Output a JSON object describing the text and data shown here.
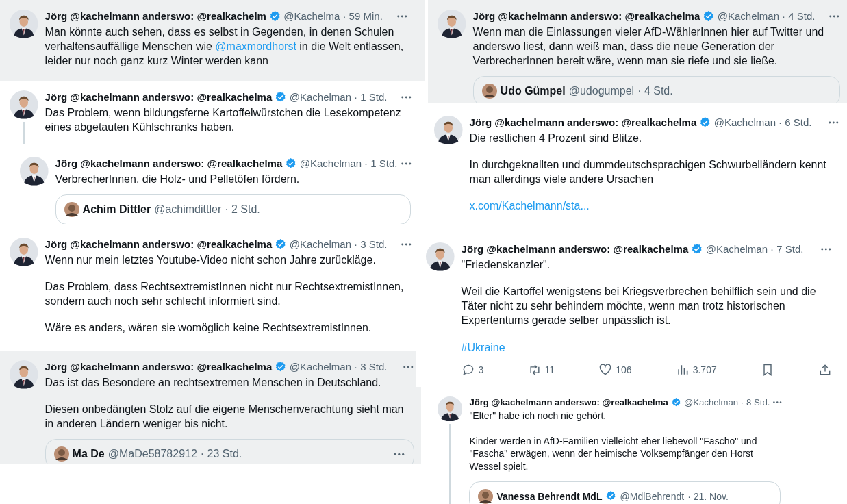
{
  "clippings": [
    {
      "shaded": true,
      "thread_continues": false,
      "author": "Jörg @kachelmann anderswo: @realkachelm",
      "verified": true,
      "handle": "@Kachelma",
      "time": "· 59 Min.",
      "paragraphs": [
        [
          {
            "kind": "text",
            "text": "Man könnte auch sehen, dass es selbst in Gegenden, in denen Schulen verhaltensauffällige Menschen wie "
          },
          {
            "kind": "link",
            "text": "@maxmordhorst"
          },
          {
            "kind": "text",
            "text": " in die Welt entlassen, leider nur noch ganz kurz Winter werden kann"
          }
        ]
      ]
    },
    {
      "shaded": false,
      "thread_continues": true,
      "author": "Jörg @kachelmann anderswo: @realkachelma",
      "verified": true,
      "handle": "@Kachelman",
      "time": "· 1 Std.",
      "paragraphs": [
        [
          {
            "kind": "text",
            "text": "Das Problem, wenn bildungsferne Kartoffelwürstchen die Lesekompetenz eines abgetauten Kühlschranks haben."
          }
        ]
      ]
    },
    {
      "shaded": false,
      "thread_continues": false,
      "author": "Jörg @kachelmann anderswo: @realkachelma",
      "verified": true,
      "handle": "@Kachelman",
      "time": "· 1 Std.",
      "paragraphs": [
        [
          {
            "kind": "text",
            "text": "VerbrecherInnen, die Holz- und Pelletöfen fördern."
          }
        ]
      ],
      "quote": {
        "name": "Achim Dittler",
        "handle": "@achimdittler",
        "time": "· 2 Std."
      }
    },
    {
      "shaded": false,
      "thread_continues": false,
      "author": "Jörg @kachelmann anderswo: @realkachelma",
      "verified": true,
      "handle": "@Kachelman",
      "time": "· 3 Std.",
      "paragraphs": [
        [
          {
            "kind": "text",
            "text": "Wenn nur mein letztes Youtube-Video nicht schon Jahre zurückläge."
          }
        ],
        [
          {
            "kind": "text",
            "text": "Das Problem, dass RechtsextremistInnen nicht nur RechtsextremistInnen, sondern auch noch sehr schlecht informiert sind."
          }
        ],
        [
          {
            "kind": "text",
            "text": "Wäre es anders, wären sie womöglich keine RechtsextremistInnen."
          }
        ]
      ]
    },
    {
      "shaded": true,
      "thread_continues": false,
      "author": "Jörg @kachelmann anderswo: @realkachelma",
      "verified": true,
      "handle": "@Kachelman",
      "time": "· 3 Std.",
      "paragraphs": [
        [
          {
            "kind": "text",
            "text": "Das ist das Besondere an rechtsextremen Menschen in Deutschland."
          }
        ],
        [
          {
            "kind": "text",
            "text": "Diesen onbedängten Stolz auf die eigene Menschenverachtung sieht man in anderen Ländern weniger bis nicht."
          }
        ]
      ],
      "quote": {
        "name": "Ma De",
        "handle": "@MaDe58782912",
        "time": "· 23 Std.",
        "more": true
      }
    },
    {
      "shaded": true,
      "thread_continues": false,
      "author": "Jörg @kachelmann anderswo: @realkachelma",
      "verified": true,
      "handle": "@Kachelman",
      "time": "· 4 Std.",
      "paragraphs": [
        [
          {
            "kind": "text",
            "text": "Wenn man die Einlassungen vieler AfD-WählerInnen hier auf Twitter und anderswo liest, dann weiß man, dass die neue Generation der VerbrecherInnen bereit wäre, wenn man sie riefe und sie ließe."
          }
        ]
      ],
      "quote": {
        "name": "Udo Gümpel",
        "handle": "@udogumpel",
        "time": "· 4 Std."
      }
    },
    {
      "shaded": false,
      "thread_continues": false,
      "author": "Jörg @kachelmann anderswo: @realkachelma",
      "verified": true,
      "handle": "@Kachelman",
      "time": "· 6 Std.",
      "paragraphs": [
        [
          {
            "kind": "text",
            "text": "Die restlichen 4 Prozent sind Blitze."
          }
        ],
        [
          {
            "kind": "text",
            "text": "In durchgeknallten und dummdeutschsprachigen Schwurbelländern kennt man allerdings viele andere Ursachen"
          }
        ],
        [
          {
            "kind": "link",
            "text": "x.com/Kachelmann/sta..."
          }
        ]
      ]
    },
    {
      "shaded": false,
      "thread_continues": false,
      "author": "Jörg @kachelmann anderswo: @realkachelma",
      "verified": true,
      "handle": "@Kachelman",
      "time": "· 7 Std.",
      "paragraphs": [
        [
          {
            "kind": "text",
            "text": "\"Friedenskanzler\"."
          }
        ],
        [
          {
            "kind": "text",
            "text": "Weil die Kartoffel wenigstens bei Kriegsverbrechen behilflich sein und die Täter nicht zu sehr behindern möchte, wenn man trotz historischen Expertentums gerade selber unpässlich ist."
          }
        ],
        [
          {
            "kind": "link",
            "text": "#Ukraine"
          }
        ]
      ],
      "actions": [
        {
          "kind": "reply",
          "count": "3"
        },
        {
          "kind": "repost",
          "count": "11"
        },
        {
          "kind": "like",
          "count": "106"
        },
        {
          "kind": "views",
          "count": "3.707"
        },
        {
          "kind": "bookmark"
        },
        {
          "kind": "share"
        }
      ]
    },
    {
      "shaded": false,
      "thread_continues": true,
      "author": "Jörg @kachelmann anderswo: @realkachelma",
      "verified": true,
      "handle": "@Kachelman",
      "time": "· 8 Std.",
      "paragraphs": [
        [
          {
            "kind": "text",
            "text": "\"Elter\" habe ich noch nie gehört."
          }
        ],
        [
          {
            "kind": "text",
            "text": "Kinder werden in AfD-Familien vielleicht eher liebevoll \"Fascho\" und \"Fascha\" erwägen, wenn der heimische Volksempfänger den Horst Wessel spielt."
          }
        ]
      ],
      "quote": {
        "name": "Vanessa Behrendt MdL",
        "verified": true,
        "handle": "@MdlBehrendt",
        "time": "· 21. Nov."
      }
    }
  ]
}
